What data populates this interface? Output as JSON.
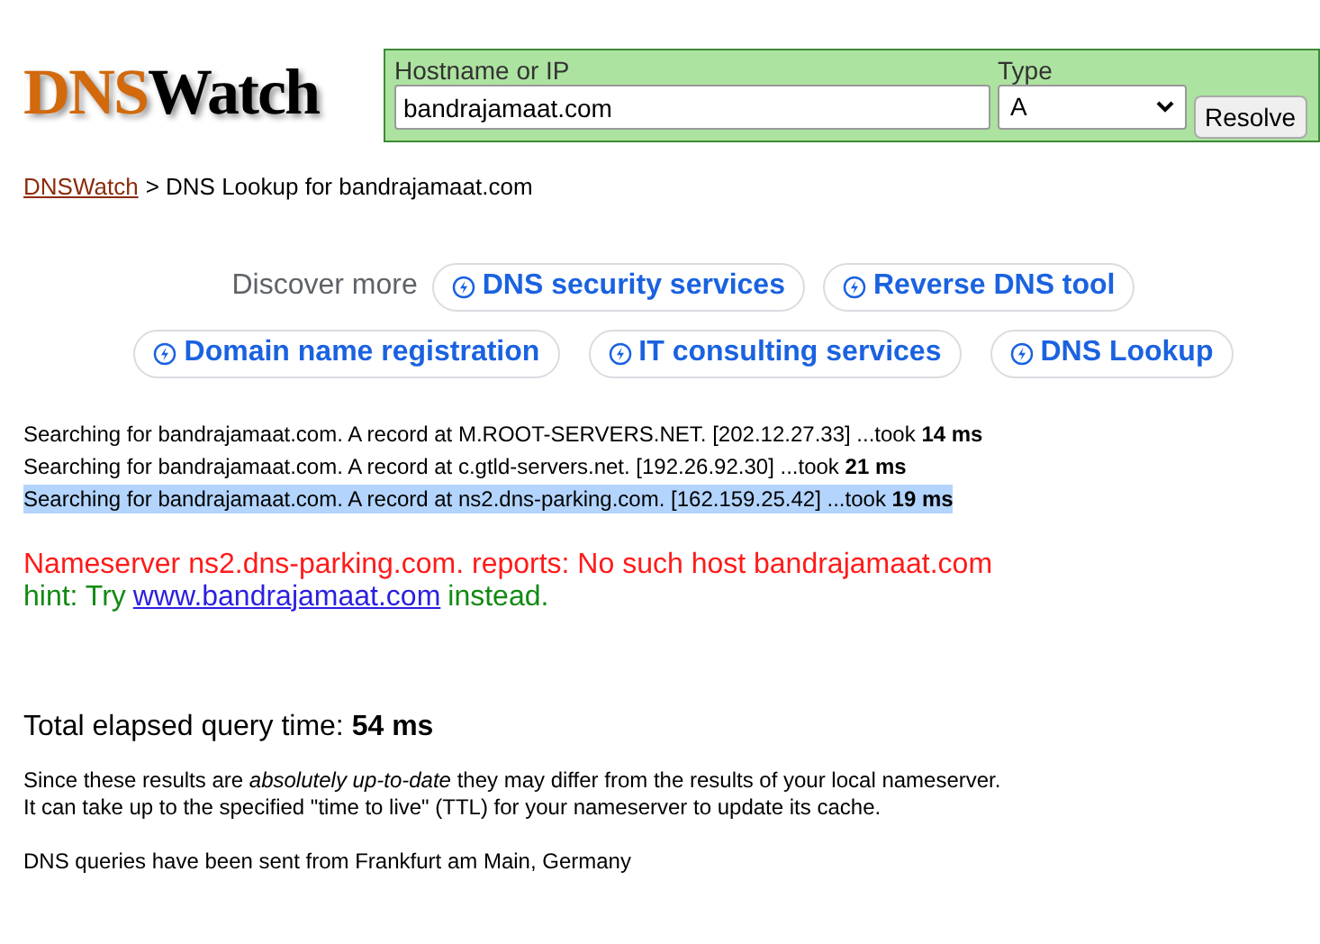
{
  "logo": {
    "part_1": "DNS",
    "part_2": "Watch"
  },
  "search": {
    "hostname_label": "Hostname or IP",
    "hostname_value": "bandrajamaat.com",
    "type_label": "Type",
    "type_value": "A",
    "button": "Resolve"
  },
  "breadcrumb": {
    "link": "DNSWatch",
    "rest": "> DNS Lookup for bandrajamaat.com"
  },
  "discover": {
    "label": "Discover more",
    "links": [
      {
        "label": "DNS security services"
      },
      {
        "label": "Reverse DNS tool"
      },
      {
        "label": "Domain name registration"
      },
      {
        "label": "IT consulting services"
      },
      {
        "label": "DNS Lookup"
      }
    ]
  },
  "lookups": [
    {
      "text": "Searching for bandrajamaat.com. A record at M.ROOT-SERVERS.NET. [202.12.27.33] ...took **14 ms**",
      "highlighted": false
    },
    {
      "text": "Searching for bandrajamaat.com. A record at c.gtld-servers.net. [192.26.92.30] ...took **21 ms**",
      "highlighted": false
    },
    {
      "text": "Searching for bandrajamaat.com. A record at ns2.dns-parking.com. [162.159.25.42] ...took **19 ms**",
      "highlighted": true
    }
  ],
  "error": "Nameserver ns2.dns-parking.com. reports: No such host bandrajamaat.com",
  "hint": {
    "prefix": "hint: Try",
    "link": "www.bandrajamaat.com",
    "suffix": "instead."
  },
  "total": "Total elapsed query time: **54 ms**",
  "notes": [
    "Since these results are *absolutely up-to-date* they may differ from the results of your local nameserver.",
    "It can take up to the specified \"time to live\" (TTL) for your nameserver to update its cache."
  ],
  "origin": "DNS queries have been sent from Frankfurt am Main, Germany"
}
